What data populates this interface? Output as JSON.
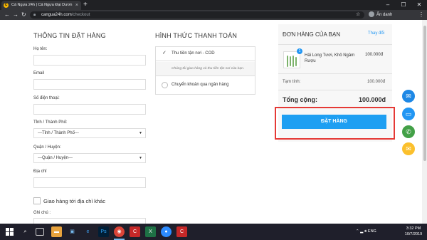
{
  "browser": {
    "tab_title": "Cá Ngựa 24h | Cá Ngựa Đại Dươn",
    "tab_close": "×",
    "new_tab": "+",
    "url_domain": "cangua24h.com",
    "url_path": "/checkout",
    "profile_label": "Ẩn danh",
    "win_min": "–",
    "win_max": "☐",
    "win_close": "✕"
  },
  "customer_info": {
    "title": "THÔNG TIN ĐẶT HÀNG",
    "name_label": "Họ tên:",
    "email_label": "Email",
    "phone_label": "Số điện thoại:",
    "province_label": "Tỉnh / Thành Phố:",
    "province_value": "---Tỉnh / Thành Phố---",
    "district_label": "Quận / Huyện:",
    "district_value": "---Quận / Huyện---",
    "address_label": "Địa chỉ",
    "ship_other_label": "Giao hàng tới địa chỉ khác",
    "note_label": "Ghi chú :"
  },
  "payment": {
    "title": "HÌNH THỨC THANH TOÁN",
    "cod_label": "Thu tiền tận nơi - COD",
    "cod_note": "Chúng tôi giao hàng và thu tiền tận nơi của bạn.",
    "bank_label": "Chuyển khoản qua ngân hàng"
  },
  "order": {
    "title": "ĐƠN HÀNG CỦA BẠN",
    "edit_label": "Thay đổi",
    "item_qty": "1",
    "item_name": "Hải Long Tươi, Khô Ngâm Rượu",
    "item_price": "100.000đ",
    "subtotal_label": "Tạm tính:",
    "subtotal_value": "100.000đ",
    "total_label": "Tổng cộng:",
    "total_value": "100.000đ",
    "submit_label": "ĐẶT HÀNG"
  },
  "colors": {
    "accent": "#1e9ff2",
    "highlight": "#e53935",
    "messenger": "#1e88e5",
    "zalo": "#2196f3",
    "phone": "#43a047",
    "email": "#fbc02d"
  },
  "taskbar": {
    "lang": "ENG",
    "time": "3:32 PM",
    "date": "10/7/2019"
  }
}
